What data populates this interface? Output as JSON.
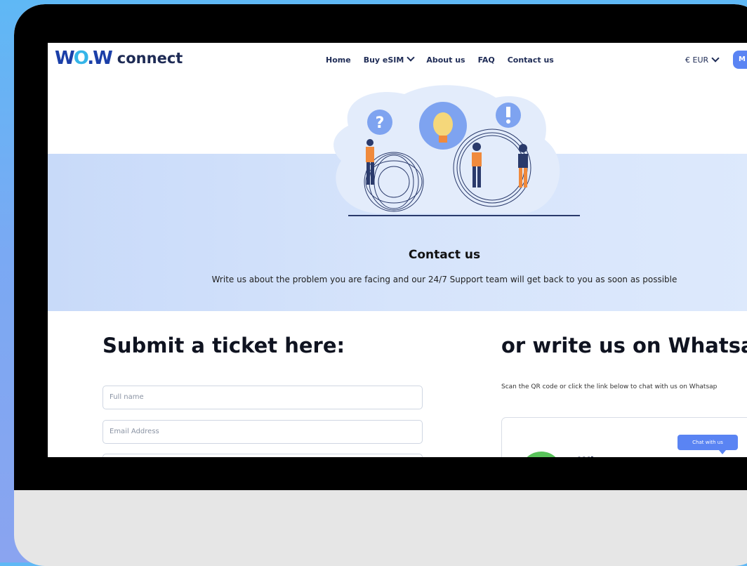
{
  "header": {
    "logo_mark": "WOW",
    "logo_text": "connect",
    "nav": [
      "Home",
      "Buy eSIM",
      "About us",
      "FAQ",
      "Contact us"
    ],
    "currency": "€ EUR",
    "login_label": "M"
  },
  "hero": {
    "title": "Contact us",
    "subtitle": "Write us about the problem you are facing and our 24/7 Support team will get back to you as soon as possible"
  },
  "ticket": {
    "title": "Submit a ticket here:",
    "fields": [
      {
        "placeholder": "Full name"
      },
      {
        "placeholder": "Email Address"
      },
      {
        "placeholder": ""
      }
    ]
  },
  "whatsapp": {
    "title": "or write us on Whatsa",
    "subtitle": "Scan the QR code or click the link below to chat with us on Whatsap",
    "chat_label": "Chat with us",
    "card_text": "Wh"
  },
  "colors": {
    "brand_blue": "#5a84f3",
    "navy": "#1e2b55",
    "hero_band": "#d6e4fb",
    "whatsapp_green": "#59c35a"
  }
}
